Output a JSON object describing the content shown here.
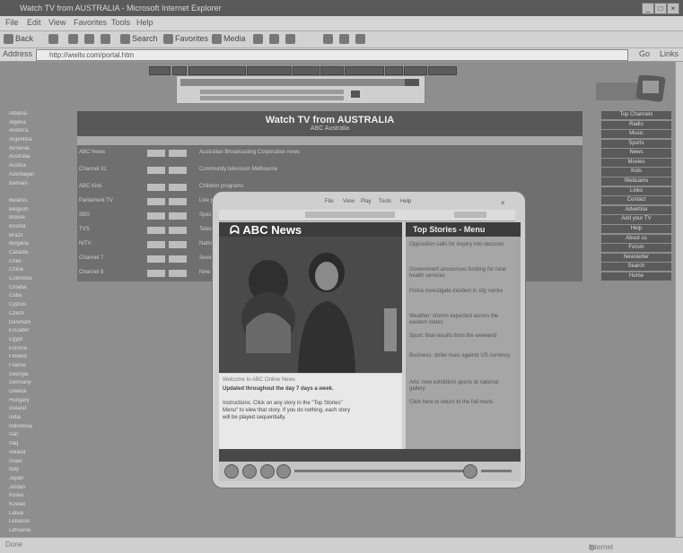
{
  "window": {
    "title": "Watch TV from AUSTRALIA - Microsoft Internet Explorer"
  },
  "menu": [
    "File",
    "Edit",
    "View",
    "Favorites",
    "Tools",
    "Help"
  ],
  "toolbar": {
    "back": "Back",
    "search": "Search",
    "favorites": "Favorites",
    "media": "Media"
  },
  "address": {
    "label": "Address",
    "url": "http://wwitv.com/portal.htm",
    "go": "Go",
    "links": "Links"
  },
  "page": {
    "title": "Watch TV from AUSTRALIA",
    "subtitle": "ABC Australia",
    "left_links": [
      "Albania",
      "Algeria",
      "Andorra",
      "Argentina",
      "Armenia",
      "Australia",
      "Austria",
      "Azerbaijan",
      "Bahrain",
      "",
      "Belarus",
      "Belgium",
      "Bolivia",
      "Bosnia",
      "Brazil",
      "Bulgaria",
      "Canada",
      "Chile",
      "China",
      "Colombia",
      "Croatia",
      "Cuba",
      "Cyprus",
      "Czech",
      "Denmark",
      "Ecuador",
      "Egypt",
      "Estonia",
      "Finland",
      "France",
      "Georgia",
      "Germany",
      "Greece",
      "Hungary",
      "Iceland",
      "India",
      "Indonesia",
      "Iran",
      "Iraq",
      "Ireland",
      "Israel",
      "Italy",
      "Japan",
      "Jordan",
      "Korea",
      "Kuwait",
      "Latvia",
      "Lebanon",
      "Lithuania"
    ],
    "right_links": [
      "Top Channels",
      "Radio",
      "Music",
      "Sports",
      "News",
      "Movies",
      "Kids",
      "Webcams",
      "Links",
      "Contact",
      "Advertise",
      "Add your TV",
      "Help",
      "About us",
      "Forum",
      "Newsletter",
      "Search",
      "Home"
    ],
    "rows": [
      {
        "name": "ABC News",
        "desc": "Australian Broadcasting Corporation news"
      },
      {
        "name": "Channel 31",
        "desc": "Community television Melbourne"
      },
      {
        "name": "ABC Kids",
        "desc": "Children programs"
      },
      {
        "name": "Parliament TV",
        "desc": "Live parliament broadcast"
      },
      {
        "name": "SBS",
        "desc": "Special Broadcasting Service"
      },
      {
        "name": "TVS",
        "desc": "Television Sydney"
      },
      {
        "name": "NITV",
        "desc": "National Indigenous TV"
      },
      {
        "name": "Channel 7",
        "desc": "Seven Network"
      },
      {
        "name": "Channel 9",
        "desc": "Nine Network"
      }
    ]
  },
  "player": {
    "menu": [
      "File",
      "View",
      "Play",
      "Tools",
      "Help"
    ],
    "brand": "ABC News",
    "topstories_title": "Top Stories - Menu",
    "caption_lines": [
      "Welcome to ABC Online News",
      "Updated throughout the day 7 days a week.",
      "Instructions: Click on any story in the \"Top Stories\"",
      "Menu\" to view that story. If you do nothing, each story",
      "will be played sequentially."
    ],
    "stories": [
      "Opposition calls for inquiry into decision",
      "Government announces funding for rural health services",
      "Police investigate incident in city centre",
      "Weather: storms expected across the eastern states",
      "Sport: final results from the weekend",
      "Business: dollar rises against US currency",
      "Arts: new exhibition opens at national gallery",
      "Click here to return to the full menu"
    ]
  },
  "status": {
    "left": "Done",
    "zone": "Internet"
  }
}
